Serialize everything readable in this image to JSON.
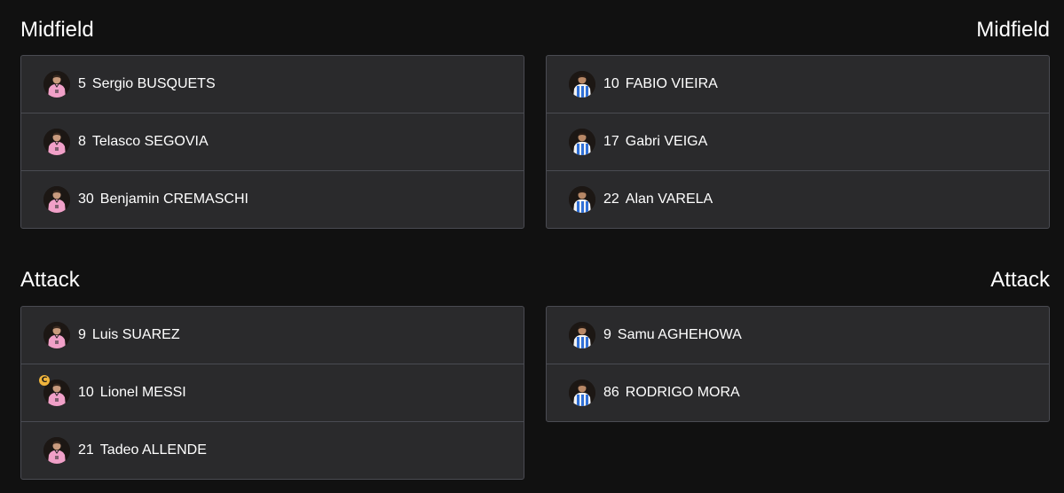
{
  "colors": {
    "background": "#111111",
    "card": "#2a2a2c",
    "border": "#4a4b52",
    "miami_kit": "#f0a0c8",
    "porto_kit_blue": "#2f6fd6",
    "captain_badge": "#f0b43c"
  },
  "home": {
    "midfield": {
      "title": "Midfield",
      "players": [
        {
          "number": "5",
          "name": "Sergio BUSQUETS",
          "captain": false
        },
        {
          "number": "8",
          "name": "Telasco SEGOVIA",
          "captain": false
        },
        {
          "number": "30",
          "name": "Benjamin CREMASCHI",
          "captain": false
        }
      ]
    },
    "attack": {
      "title": "Attack",
      "players": [
        {
          "number": "9",
          "name": "Luis SUAREZ",
          "captain": false
        },
        {
          "number": "10",
          "name": "Lionel MESSI",
          "captain": true,
          "captain_label": "C"
        },
        {
          "number": "21",
          "name": "Tadeo ALLENDE",
          "captain": false
        }
      ]
    }
  },
  "away": {
    "midfield": {
      "title": "Midfield",
      "players": [
        {
          "number": "10",
          "name": "FABIO VIEIRA",
          "captain": false
        },
        {
          "number": "17",
          "name": "Gabri VEIGA",
          "captain": false
        },
        {
          "number": "22",
          "name": "Alan VARELA",
          "captain": false
        }
      ]
    },
    "attack": {
      "title": "Attack",
      "players": [
        {
          "number": "9",
          "name": "Samu AGHEHOWA",
          "captain": false
        },
        {
          "number": "86",
          "name": "RODRIGO MORA",
          "captain": false
        }
      ]
    }
  },
  "icons": {
    "home_avatar": "player-photo-pink-kit-icon",
    "away_avatar": "player-photo-blue-white-kit-icon",
    "captain": "captain-badge-icon"
  }
}
